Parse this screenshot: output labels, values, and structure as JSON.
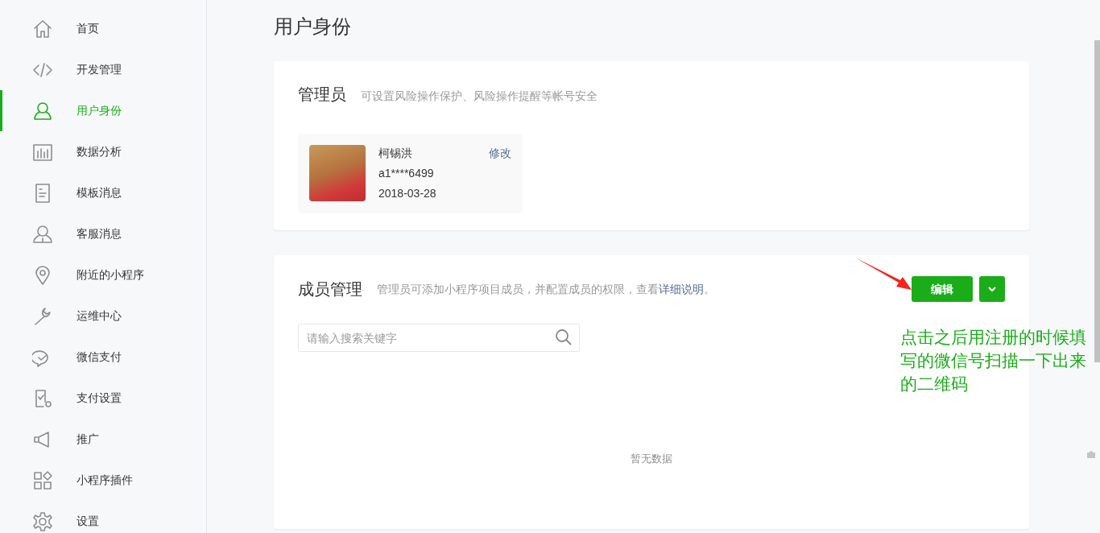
{
  "sidebar": {
    "items": [
      {
        "label": "首页",
        "selected": false
      },
      {
        "label": "开发管理",
        "selected": false
      },
      {
        "label": "用户身份",
        "selected": true
      },
      {
        "label": "数据分析",
        "selected": false
      },
      {
        "label": "模板消息",
        "selected": false
      },
      {
        "label": "客服消息",
        "selected": false
      },
      {
        "label": "附近的小程序",
        "selected": false
      },
      {
        "label": "运维中心",
        "selected": false
      },
      {
        "label": "微信支付",
        "selected": false
      },
      {
        "label": "支付设置",
        "selected": false
      },
      {
        "label": "推广",
        "selected": false
      },
      {
        "label": "小程序插件",
        "selected": false
      },
      {
        "label": "设置",
        "selected": false
      }
    ]
  },
  "page_title": "用户身份",
  "admin_card": {
    "title": "管理员",
    "description": "可设置风险操作保护、风险操作提醒等帐号安全",
    "admin": {
      "name": "柯锡洪",
      "account": "a1****6499",
      "date": "2018-03-28",
      "edit_link": "修改"
    }
  },
  "members_card": {
    "title": "成员管理",
    "description": "管理员可添加小程序项目成员，并配置成员的权限，查看",
    "link": "详细说明",
    "description_end": "。",
    "edit_button": "编辑",
    "search": {
      "placeholder": "请输入搜索关键字"
    },
    "empty_text": "暂无数据"
  },
  "annotation": {
    "text": "点击之后用注册的时候填写的微信号扫描一下出来的二维码"
  }
}
